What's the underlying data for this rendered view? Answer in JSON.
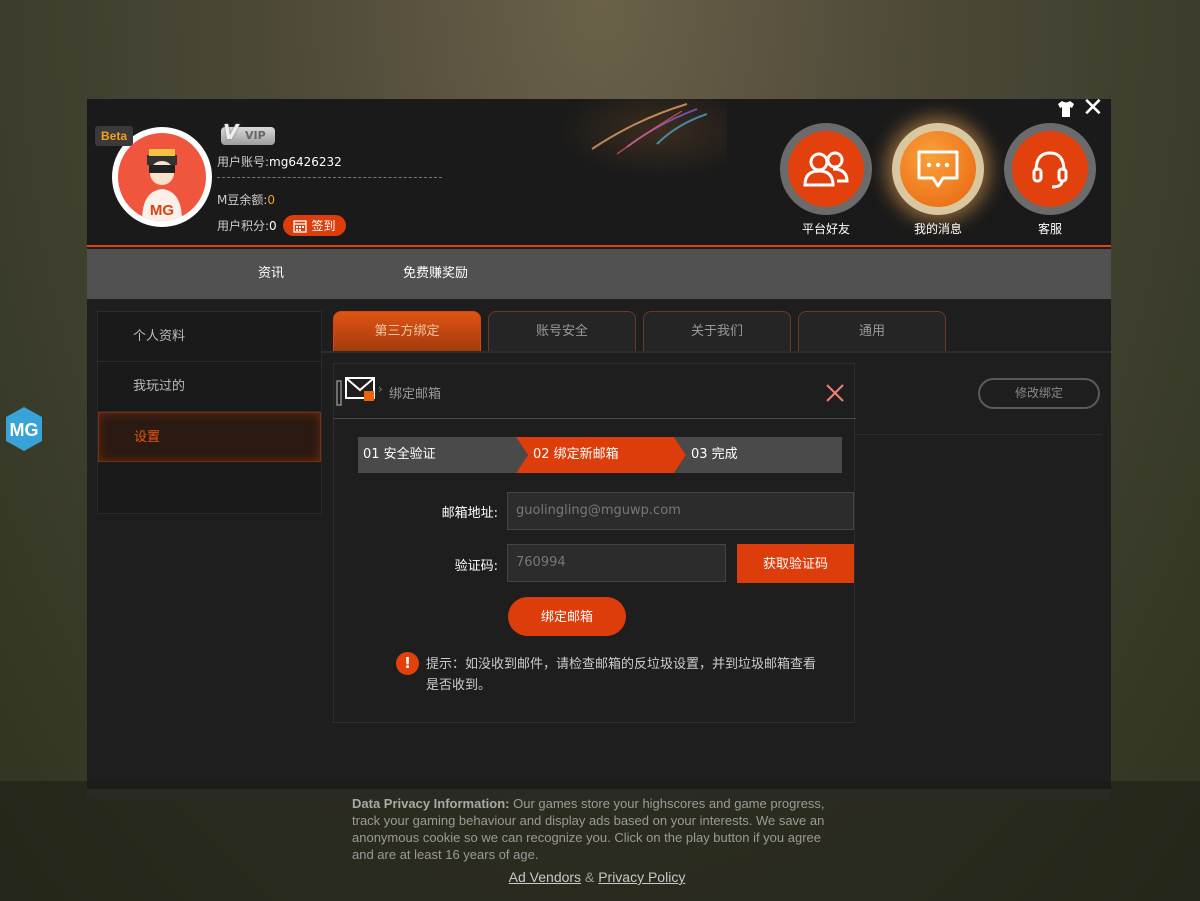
{
  "header": {
    "beta_badge": "Beta",
    "vip_badge": "VIP",
    "account_label": "用户账号:",
    "account_value": "mg6426232",
    "balance_label": "M豆余额:",
    "balance_value": "0",
    "points_label": "用户积分:",
    "points_value": "0",
    "signin_label": "签到",
    "circles": [
      {
        "label": "平台好友",
        "icon": "friends-icon"
      },
      {
        "label": "我的消息",
        "icon": "message-icon"
      },
      {
        "label": "客服",
        "icon": "headset-icon"
      }
    ]
  },
  "nav": {
    "items": [
      "资讯",
      "免费赚奖励"
    ]
  },
  "sidebar": {
    "items": [
      "个人资料",
      "我玩过的",
      "设置"
    ],
    "active": "设置"
  },
  "tabs": {
    "items": [
      "第三方绑定",
      "账号安全",
      "关于我们",
      "通用"
    ],
    "active": "第三方绑定"
  },
  "modify_binding_label": "修改绑定",
  "dialog": {
    "title": "绑定邮箱",
    "steps": [
      "01 安全验证",
      "02 绑定新邮箱",
      "03 完成"
    ],
    "active_step": 1,
    "email_label": "邮箱地址:",
    "email_value": "guolingling@mguwp.com",
    "code_label": "验证码:",
    "code_value": "760994",
    "get_code_label": "获取验证码",
    "bind_label": "绑定邮箱",
    "tip_text": "提示：如没收到邮件，请检查邮箱的反垃圾设置，并到垃圾邮箱查看是否收到。"
  },
  "privacy": {
    "heading": "Data Privacy Information:",
    "body": " Our games store your highscores and game progress, track your gaming behaviour and display ads based on your interests. We save an anonymous cookie so we can recognize you. Click on the play button if you agree and are at least 16 years of age.",
    "ad_vendors": "Ad Vendors",
    "amp": "&",
    "privacy_policy": "Privacy Policy"
  },
  "colors": {
    "accent": "#dd3c0b",
    "window_bg": "#1e1e1e",
    "nav_bg": "#515151"
  }
}
